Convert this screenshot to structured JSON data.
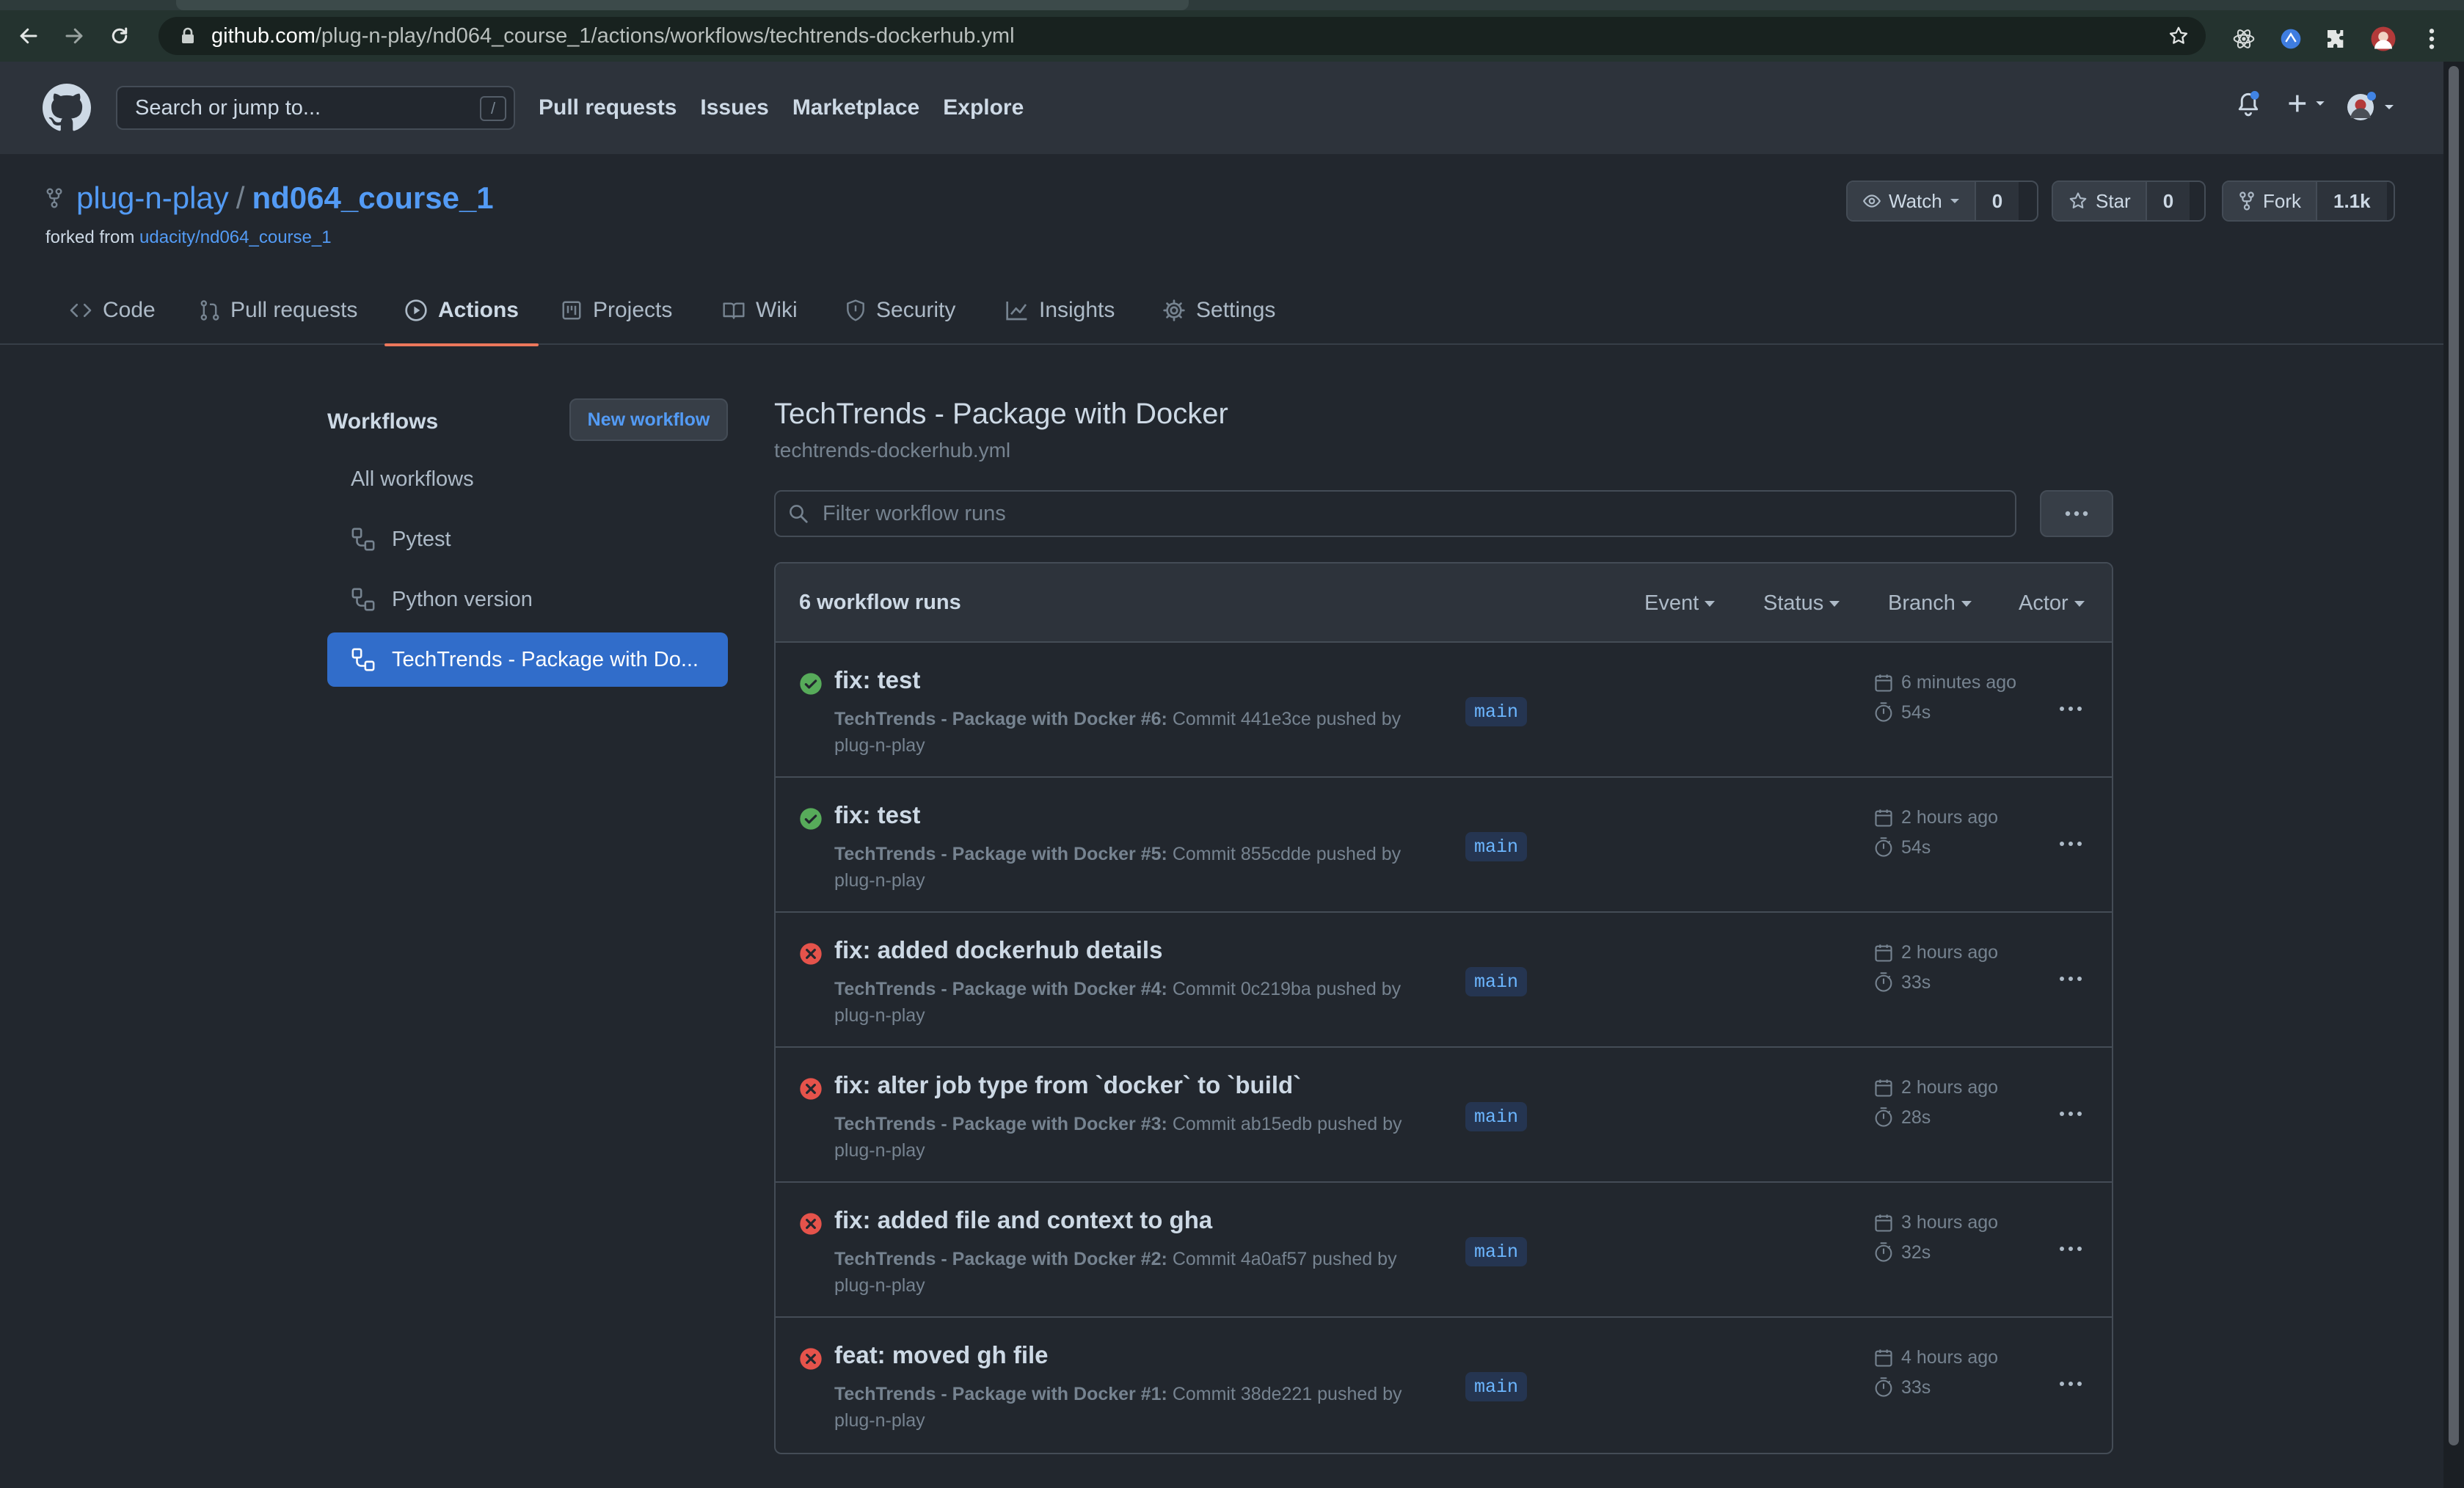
{
  "browser": {
    "url_host": "github.com",
    "url_path": "/plug-n-play/nd064_course_1/actions/workflows/techtrends-dockerhub.yml"
  },
  "header": {
    "search_placeholder": "Search or jump to...",
    "search_shortcut": "/",
    "nav": [
      "Pull requests",
      "Issues",
      "Marketplace",
      "Explore"
    ]
  },
  "repo": {
    "owner": "plug-n-play",
    "separator": "/",
    "name": "nd064_course_1",
    "forked_prefix": "forked from",
    "forked_source": "udacity/nd064_course_1",
    "watch_label": "Watch",
    "watch_count": "0",
    "star_label": "Star",
    "star_count": "0",
    "fork_label": "Fork",
    "fork_count": "1.1k"
  },
  "tabs": [
    "Code",
    "Pull requests",
    "Actions",
    "Projects",
    "Wiki",
    "Security",
    "Insights",
    "Settings"
  ],
  "active_tab": "Actions",
  "sidebar": {
    "title": "Workflows",
    "new_workflow": "New workflow",
    "items": [
      "All workflows",
      "Pytest",
      "Python version",
      "TechTrends - Package with Do..."
    ],
    "active_item": "TechTrends - Package with Do..."
  },
  "main": {
    "title": "TechTrends - Package with Docker",
    "file": "techtrends-dockerhub.yml",
    "filter_placeholder": "Filter workflow runs",
    "runs_count": "6 workflow runs",
    "filters": [
      "Event",
      "Status",
      "Branch",
      "Actor"
    ]
  },
  "runs": [
    {
      "status": "success",
      "title": "fix: test",
      "workflow": "TechTrends - Package with Docker #6:",
      "detail": "Commit 441e3ce pushed by",
      "actor": "plug-n-play",
      "branch": "main",
      "ago": "6 minutes ago",
      "duration": "54s"
    },
    {
      "status": "success",
      "title": "fix: test",
      "workflow": "TechTrends - Package with Docker #5:",
      "detail": "Commit 855cdde pushed by",
      "actor": "plug-n-play",
      "branch": "main",
      "ago": "2 hours ago",
      "duration": "54s"
    },
    {
      "status": "failure",
      "title": "fix: added dockerhub details",
      "workflow": "TechTrends - Package with Docker #4:",
      "detail": "Commit 0c219ba pushed by",
      "actor": "plug-n-play",
      "branch": "main",
      "ago": "2 hours ago",
      "duration": "33s"
    },
    {
      "status": "failure",
      "title": "fix: alter job type from `docker` to `build`",
      "workflow": "TechTrends - Package with Docker #3:",
      "detail": "Commit ab15edb pushed by",
      "actor": "plug-n-play",
      "branch": "main",
      "ago": "2 hours ago",
      "duration": "28s"
    },
    {
      "status": "failure",
      "title": "fix: added file and context to gha",
      "workflow": "TechTrends - Package with Docker #2:",
      "detail": "Commit 4a0af57 pushed by",
      "actor": "plug-n-play",
      "branch": "main",
      "ago": "3 hours ago",
      "duration": "32s"
    },
    {
      "status": "failure",
      "title": "feat: moved gh file",
      "workflow": "TechTrends - Package with Docker #1:",
      "detail": "Commit 38de221 pushed by",
      "actor": "plug-n-play",
      "branch": "main",
      "ago": "4 hours ago",
      "duration": "33s"
    }
  ],
  "colors": {
    "success": "#57ab5a",
    "failure": "#e5534b",
    "link": "#539bf5",
    "active_tab_underline": "#ec775c",
    "selected_item": "#316dca"
  }
}
